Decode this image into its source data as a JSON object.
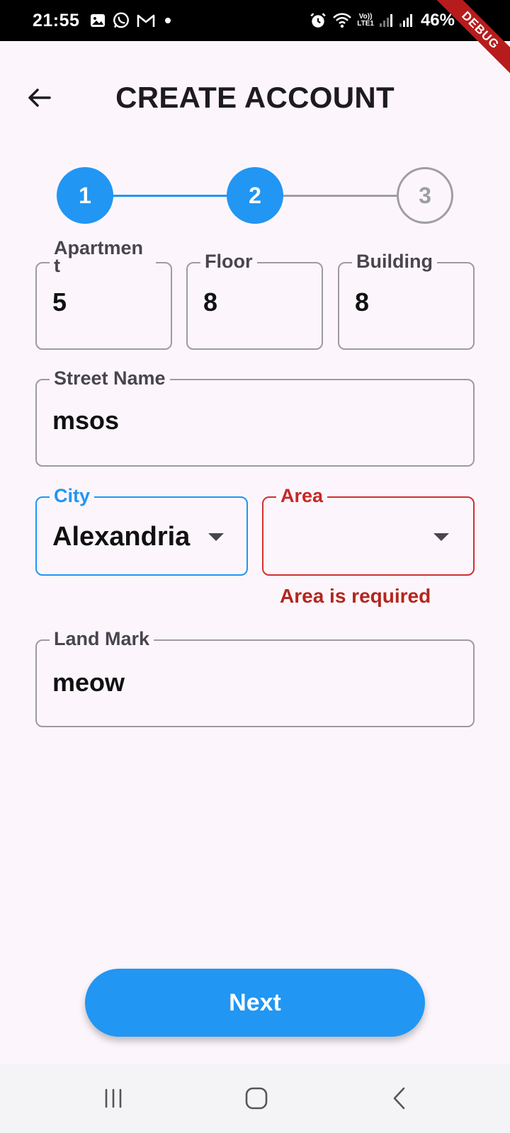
{
  "status_bar": {
    "time": "21:55",
    "battery": "46%",
    "network_top": "Vo))",
    "network_bottom": "LTE1",
    "icons": [
      "image-icon",
      "whatsapp-icon",
      "gmail-icon",
      "dot-icon",
      "alarm-icon",
      "wifi-icon",
      "signal-icon",
      "signal-icon"
    ]
  },
  "debug_banner": "DEBUG",
  "header": {
    "title": "CREATE ACCOUNT"
  },
  "stepper": {
    "steps": [
      {
        "label": "1",
        "state": "active"
      },
      {
        "label": "2",
        "state": "active"
      },
      {
        "label": "3",
        "state": "inactive"
      }
    ],
    "active_color": "#2196f3",
    "inactive_color": "#9e9e9e"
  },
  "form": {
    "apartment": {
      "label": "Apartmen\nt",
      "value": "5"
    },
    "floor": {
      "label": "Floor",
      "value": "8"
    },
    "building": {
      "label": "Building",
      "value": "8"
    },
    "street_name": {
      "label": "Street Name",
      "value": "msos"
    },
    "city": {
      "label": "City",
      "value": "Alexandria"
    },
    "area": {
      "label": "Area",
      "value": "",
      "error": "Area is required"
    },
    "land_mark": {
      "label": "Land Mark",
      "value": "meow"
    }
  },
  "actions": {
    "next_label": "Next"
  },
  "colors": {
    "accent": "#2196f3",
    "error": "#b3261e",
    "background": "#fcf6fc"
  }
}
